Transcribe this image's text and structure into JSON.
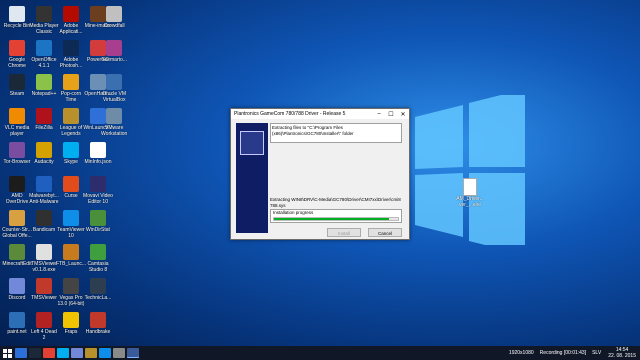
{
  "desktop_icons": [
    {
      "label": "Recycle Bin",
      "color": "#dfe8f0",
      "col": 0,
      "row": 0
    },
    {
      "label": "Media Player Classic",
      "color": "#333333",
      "col": 1,
      "row": 0
    },
    {
      "label": "Adobe Applicati...",
      "color": "#b30b00",
      "col": 2,
      "row": 0
    },
    {
      "label": "Mine-imator",
      "color": "#6a3e1e",
      "col": 3,
      "row": 0
    },
    {
      "label": "Crowdfall",
      "color": "#c0c0c0",
      "col": 3.6,
      "row": 0
    },
    {
      "label": "Google Chrome",
      "color": "#e34133",
      "col": 0,
      "row": 1
    },
    {
      "label": "OpenOffice 4.1.1",
      "color": "#1b74c4",
      "col": 1,
      "row": 1
    },
    {
      "label": "Adobe Photosh...",
      "color": "#0d2a55",
      "col": 2,
      "row": 1
    },
    {
      "label": "PowerGO",
      "color": "#d23c3c",
      "col": 3,
      "row": 1
    },
    {
      "label": "freemarto...",
      "color": "#a83e8e",
      "col": 3.6,
      "row": 1
    },
    {
      "label": "Steam",
      "color": "#1b2838",
      "col": 0,
      "row": 2
    },
    {
      "label": "Notepad++",
      "color": "#8bc34a",
      "col": 1,
      "row": 2
    },
    {
      "label": "Pop-corn Time",
      "color": "#e8a21a",
      "col": 2,
      "row": 2
    },
    {
      "label": "OpenHard...",
      "color": "#6b8fb5",
      "col": 3,
      "row": 2
    },
    {
      "label": "Oracle VM VirtualBox",
      "color": "#3a6fb0",
      "col": 3.6,
      "row": 2
    },
    {
      "label": "VLC media player",
      "color": "#f08a00",
      "col": 0,
      "row": 3
    },
    {
      "label": "FileZilla",
      "color": "#b0121b",
      "col": 1,
      "row": 3
    },
    {
      "label": "League of Legends",
      "color": "#b8912c",
      "col": 2,
      "row": 3
    },
    {
      "label": "WinLaunch...",
      "color": "#2e6fd8",
      "col": 3,
      "row": 3
    },
    {
      "label": "VMware Workstation",
      "color": "#6e8ca8",
      "col": 3.6,
      "row": 3
    },
    {
      "label": "Tor-Browser",
      "color": "#7a4da0",
      "col": 0,
      "row": 4
    },
    {
      "label": "Audacity",
      "color": "#d4a200",
      "col": 1,
      "row": 4
    },
    {
      "label": "Skype",
      "color": "#00aff0",
      "col": 2,
      "row": 4
    },
    {
      "label": "MinInfo.json",
      "color": "#ffffff",
      "col": 3,
      "row": 4
    },
    {
      "label": "AMD OverDrive",
      "color": "#1c1c1c",
      "col": 0,
      "row": 5
    },
    {
      "label": "Malwarebyt... Anti-Malware",
      "color": "#1f5fbf",
      "col": 1,
      "row": 5
    },
    {
      "label": "Curse",
      "color": "#e24b1b",
      "col": 2,
      "row": 5
    },
    {
      "label": "Movavi Video Editor 10",
      "color": "#2d2d6d",
      "col": 3,
      "row": 5
    },
    {
      "label": "Counter-Str... Global Offe...",
      "color": "#d8a040",
      "col": 0,
      "row": 6
    },
    {
      "label": "Bandicam",
      "color": "#303030",
      "col": 1,
      "row": 6
    },
    {
      "label": "TeamViewer 10",
      "color": "#0e8ee9",
      "col": 2,
      "row": 6
    },
    {
      "label": "WinDirStat",
      "color": "#4a8f3a",
      "col": 3,
      "row": 6
    },
    {
      "label": "MinecraftEdit",
      "color": "#5a8a3a",
      "col": 0,
      "row": 7
    },
    {
      "label": "TMSViewer v0.1.8.exe",
      "color": "#e0e0e0",
      "col": 1,
      "row": 7
    },
    {
      "label": "FTB_Launc...",
      "color": "#c87a1e",
      "col": 2,
      "row": 7
    },
    {
      "label": "Camtasia Studio 8",
      "color": "#3f9f3f",
      "col": 3,
      "row": 7
    },
    {
      "label": "Discord",
      "color": "#7289da",
      "col": 0,
      "row": 8
    },
    {
      "label": "TMSViewer",
      "color": "#c0392b",
      "col": 1,
      "row": 8
    },
    {
      "label": "Vegas Pro 13.0 (64-bit)",
      "color": "#444444",
      "col": 2,
      "row": 8
    },
    {
      "label": "TechnicLa...",
      "color": "#2c3e50",
      "col": 3,
      "row": 8
    },
    {
      "label": "paint.net",
      "color": "#2c6fb7",
      "col": 0,
      "row": 9
    },
    {
      "label": "Left 4 Dead 2",
      "color": "#b22222",
      "col": 1,
      "row": 9
    },
    {
      "label": "Fraps",
      "color": "#f0c400",
      "col": 2,
      "row": 9
    },
    {
      "label": "Handbrake",
      "color": "#c0392b",
      "col": 3,
      "row": 9
    }
  ],
  "desktop_file": {
    "label": "AM_Driver... ver_...exe"
  },
  "dialog": {
    "title": "Plantronics GameCom 780/788 Driver - Release 5",
    "minimize": "–",
    "maximize": "☐",
    "close": "✕",
    "message": "Extracting files to \"C:\\Program Files (x86)\\Plantronics\\GC780\\Installer\\\" folder",
    "extracting": "Extracting WIN8\\DRV\\C-Media\\GC780\\Driver\\CMI7xx\\Driver\\cmi8 788.sys",
    "progress_label": "Installation progress",
    "progress": 0.93,
    "install_btn": "Install",
    "cancel_btn": "Cancel"
  },
  "taskbar": {
    "recording": "1920x1080",
    "recording2": "Recording [00:01:43]",
    "lang": "SLV",
    "time": "14:54",
    "date": "22. 08. 2015"
  }
}
